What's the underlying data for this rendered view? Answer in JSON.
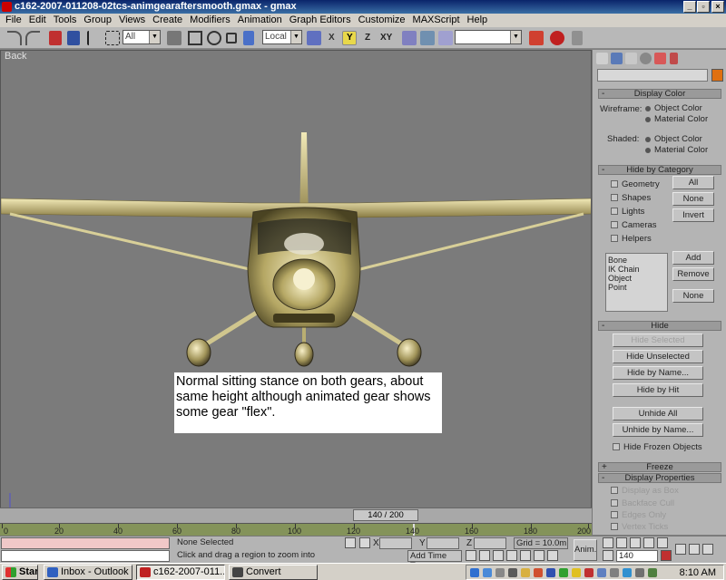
{
  "window": {
    "title": "c162-2007-011208-02tcs-animgearaftersmooth.gmax - gmax"
  },
  "menu": [
    "File",
    "Edit",
    "Tools",
    "Group",
    "Views",
    "Create",
    "Modifiers",
    "Animation",
    "Graph Editors",
    "Customize",
    "MAXScript",
    "Help"
  ],
  "toolbar": {
    "filter_value": "All",
    "coord_value": "Local",
    "axis_x": "X",
    "axis_y": "Y",
    "axis_z": "Z",
    "axis_xy": "XY"
  },
  "viewport": {
    "label": "Back",
    "note": "Normal sitting stance on both gears, about same height although animated gear shows some gear \"flex\"."
  },
  "panel": {
    "display_color": {
      "title": "Display Color",
      "wireframe_label": "Wireframe:",
      "shaded_label": "Shaded:",
      "object_color": "Object Color",
      "material_color": "Material Color"
    },
    "hide_by_category": {
      "title": "Hide by Category",
      "items": [
        "Geometry",
        "Shapes",
        "Lights",
        "Cameras",
        "Helpers"
      ],
      "btn_all": "All",
      "btn_none": "None",
      "btn_invert": "Invert",
      "list": [
        "Bone",
        "IK Chain Object",
        "Point"
      ],
      "btn_add": "Add",
      "btn_remove": "Remove",
      "btn_none2": "None"
    },
    "hide": {
      "title": "Hide",
      "hide_selected": "Hide Selected",
      "hide_unselected": "Hide Unselected",
      "hide_by_name": "Hide by Name...",
      "hide_by_hit": "Hide by Hit",
      "unhide_all": "Unhide All",
      "unhide_by_name": "Unhide by Name...",
      "hide_frozen": "Hide Frozen Objects"
    },
    "freeze": {
      "title": "Freeze"
    },
    "display_properties": {
      "title": "Display Properties",
      "items": [
        "Display as Box",
        "Backface Cull",
        "Edges Only",
        "Vertex Ticks"
      ]
    }
  },
  "timeline": {
    "slider_label": "140 / 200",
    "ticks": [
      "0",
      "20",
      "40",
      "60",
      "80",
      "100",
      "120",
      "140",
      "160",
      "180",
      "200"
    ]
  },
  "status": {
    "selection": "None Selected",
    "prompt": "Click and drag a region to zoom into",
    "x_label": "X",
    "y_label": "Y",
    "z_label": "Z",
    "grid": "Grid = 10.0m",
    "add_time_tag": "Add Time Tag",
    "anim": "Anim.",
    "frame": "140"
  },
  "taskbar": {
    "start": "Start",
    "tasks": [
      "Inbox - Outlook E...",
      "c162-2007-011...",
      "Convert"
    ],
    "clock": "8:10 AM"
  }
}
